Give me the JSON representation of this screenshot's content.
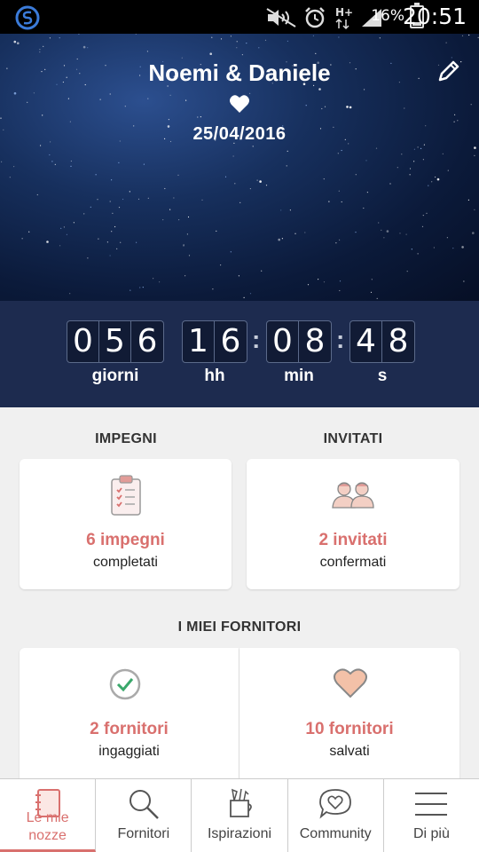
{
  "status_bar": {
    "battery": "16%",
    "time": "20:51",
    "network": "H+"
  },
  "header": {
    "couple": "Noemi & Daniele",
    "date": "25/04/2016"
  },
  "countdown": {
    "days_digits": [
      "0",
      "5",
      "6"
    ],
    "hours_digits": [
      "1",
      "6"
    ],
    "minutes_digits": [
      "0",
      "8"
    ],
    "seconds_digits": [
      "4",
      "8"
    ],
    "separator": ":",
    "labels": {
      "days": "giorni",
      "hours": "hh",
      "minutes": "min",
      "seconds": "s"
    }
  },
  "sections": {
    "impegni_title": "IMPEGNI",
    "invitati_title": "INVITATI",
    "fornitori_title": "I MIEI FORNITORI"
  },
  "cards": {
    "impegni": {
      "value": "6 impegni",
      "sub": "completati"
    },
    "invitati": {
      "value": "2 invitati",
      "sub": "confermati"
    },
    "ingaggiati": {
      "value": "2 fornitori",
      "sub": "ingaggiati"
    },
    "salvati": {
      "value": "10 fornitori",
      "sub": "salvati"
    }
  },
  "nav": {
    "items": [
      {
        "label": "Le mie nozze",
        "line1": "Le mie",
        "line2": "nozze",
        "icon": "notebook-icon",
        "active": true
      },
      {
        "label": "Fornitori",
        "icon": "magnifier-icon",
        "active": false
      },
      {
        "label": "Ispirazioni",
        "icon": "inspiration-cup-icon",
        "active": false
      },
      {
        "label": "Community",
        "icon": "chat-heart-icon",
        "active": false
      },
      {
        "label": "Di più",
        "icon": "hamburger-menu-icon",
        "active": false
      }
    ]
  },
  "colors": {
    "accent": "#d9706e",
    "countdown_bg": "#1d2b4f",
    "hero_bg": "#0b1a3a"
  }
}
